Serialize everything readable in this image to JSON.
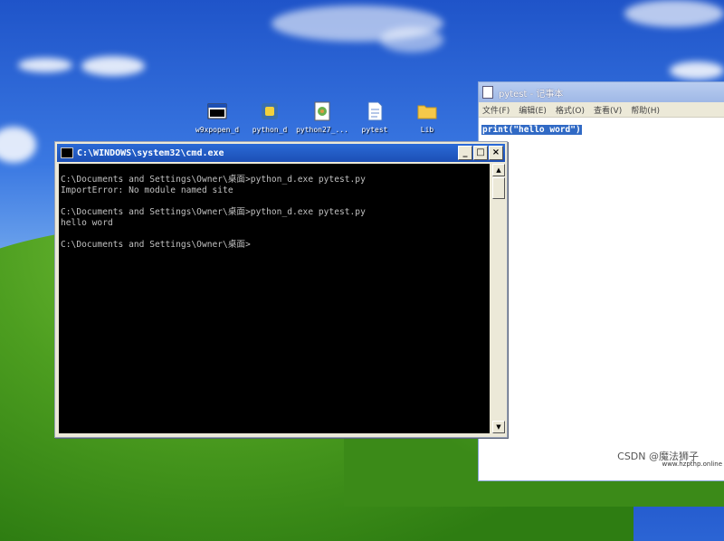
{
  "desktop": {
    "icons": [
      {
        "label": "w9xpopen_d",
        "icon": "console-app-icon"
      },
      {
        "label": "python_d",
        "icon": "python-icon"
      },
      {
        "label": "python27_...",
        "icon": "python-dll-icon"
      },
      {
        "label": "pytest",
        "icon": "text-file-icon"
      },
      {
        "label": "Lib",
        "icon": "folder-icon"
      }
    ]
  },
  "notepad": {
    "title": "pytest - 记事本",
    "menu": [
      "文件(F)",
      "编辑(E)",
      "格式(O)",
      "查看(V)",
      "帮助(H)"
    ],
    "content": "print(\"hello word\")"
  },
  "cmd": {
    "title": "C:\\WINDOWS\\system32\\cmd.exe",
    "buttons": {
      "minimize": "_",
      "maximize": "□",
      "close": "×"
    },
    "lines": [
      "",
      "C:\\Documents and Settings\\Owner\\桌面>python_d.exe pytest.py",
      "ImportError: No module named site",
      "",
      "C:\\Documents and Settings\\Owner\\桌面>python_d.exe pytest.py",
      "hello word",
      "",
      "C:\\Documents and Settings\\Owner\\桌面>"
    ],
    "scroll": {
      "up": "▲",
      "down": "▼"
    }
  },
  "watermark": {
    "main": "CSDN @魔法狮子",
    "site": "www.hzpthp.online"
  },
  "colors": {
    "titlebar": "#1c4fb5",
    "console_bg": "#000000",
    "console_fg": "#c0c0c0",
    "selection": "#316ac5"
  }
}
